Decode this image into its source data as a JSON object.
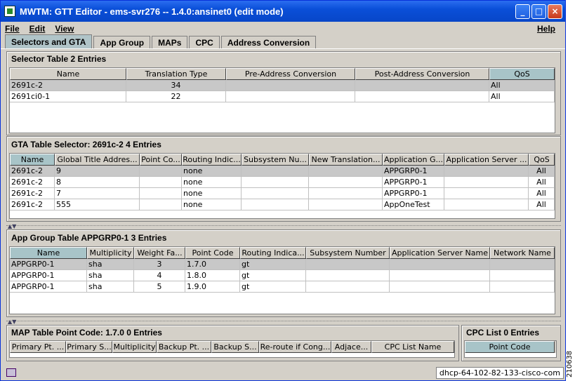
{
  "window": {
    "title": "MWTM:  GTT Editor - ems-svr276 -- 1.4.0:ansinet0 (edit mode)",
    "min_label": "_",
    "max_label": "□",
    "close_label": "×"
  },
  "menu": {
    "file": "File",
    "edit": "Edit",
    "view": "View",
    "help": "Help"
  },
  "tabs": [
    "Selectors and GTA",
    "App Group",
    "MAPs",
    "CPC",
    "Address Conversion"
  ],
  "selector": {
    "label": "Selector Table  2 Entries",
    "headers": [
      "Name",
      "Translation Type",
      "Pre-Address Conversion",
      "Post-Address Conversion",
      "QoS"
    ],
    "rows": [
      [
        "2691c-2",
        "34",
        "",
        "",
        "All"
      ],
      [
        "2691ci0-1",
        "22",
        "",
        "",
        "All"
      ]
    ]
  },
  "gta": {
    "label": "GTA Table  Selector: 2691c-2  4 Entries",
    "headers": [
      "Name",
      "Global Title Addres...",
      "Point Co...",
      "Routing Indic...",
      "Subsystem Nu...",
      "New Translation...",
      "Application G...",
      "Application Server ...",
      "QoS"
    ],
    "rows": [
      [
        "2691c-2",
        "9",
        "",
        "none",
        "",
        "",
        "APPGRP0-1",
        "",
        "All"
      ],
      [
        "2691c-2",
        "8",
        "",
        "none",
        "",
        "",
        "APPGRP0-1",
        "",
        "All"
      ],
      [
        "2691c-2",
        "7",
        "",
        "none",
        "",
        "",
        "APPGRP0-1",
        "",
        "All"
      ],
      [
        "2691c-2",
        "555",
        "",
        "none",
        "",
        "",
        "AppOneTest",
        "",
        "All"
      ]
    ]
  },
  "appgroup": {
    "label": "App Group Table APPGRP0-1  3 Entries",
    "headers": [
      "Name",
      "Multiplicity",
      "Weight Fa...",
      "Point Code",
      "Routing Indica...",
      "Subsystem Number",
      "Application Server Name",
      "Network Name"
    ],
    "rows": [
      [
        "APPGRP0-1",
        "sha",
        "3",
        "1.7.0",
        "gt",
        "",
        "",
        ""
      ],
      [
        "APPGRP0-1",
        "sha",
        "4",
        "1.8.0",
        "gt",
        "",
        "",
        ""
      ],
      [
        "APPGRP0-1",
        "sha",
        "5",
        "1.9.0",
        "gt",
        "",
        "",
        ""
      ]
    ]
  },
  "map": {
    "label": "MAP Table  Point Code: 1.7.0  0 Entries",
    "headers": [
      "Primary Pt. ...",
      "Primary S...",
      "Multiplicity",
      "Backup Pt. ...",
      "Backup S...",
      "Re-route if Cong...",
      "Adjace...",
      "CPC List Name"
    ]
  },
  "cpc": {
    "label": "CPC List  0 Entries",
    "headers": [
      "Point Code"
    ]
  },
  "status": {
    "host": "dhcp-64-102-82-133-cisco-com"
  },
  "side_code": "210638"
}
